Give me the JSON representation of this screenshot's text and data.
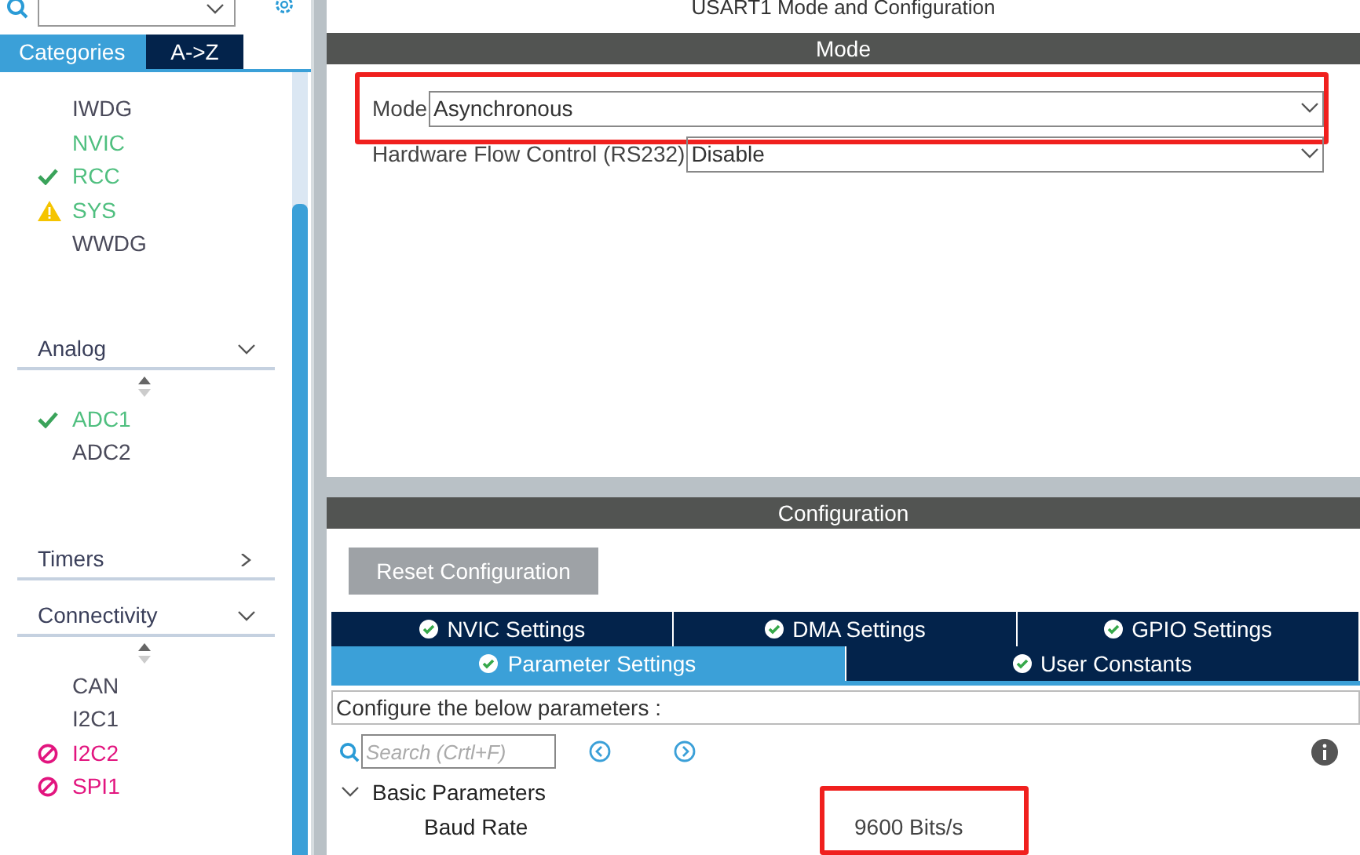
{
  "sidebar": {
    "tabs": [
      {
        "label": "Categories",
        "selected": true
      },
      {
        "label": "A->Z",
        "selected": false
      }
    ],
    "groups": [
      {
        "items": [
          {
            "label": "IWDG",
            "kind": "plain"
          },
          {
            "label": "NVIC",
            "kind": "enabled"
          },
          {
            "label": "RCC",
            "kind": "ok"
          },
          {
            "label": "SYS",
            "kind": "warning"
          },
          {
            "label": "WWDG",
            "kind": "plain"
          }
        ]
      },
      {
        "title": "Analog",
        "expanded": true,
        "items": [
          {
            "label": "ADC1",
            "kind": "ok"
          },
          {
            "label": "ADC2",
            "kind": "plain"
          }
        ]
      },
      {
        "title": "Timers",
        "expanded": false
      },
      {
        "title": "Connectivity",
        "expanded": true,
        "items": [
          {
            "label": "CAN",
            "kind": "plain"
          },
          {
            "label": "I2C1",
            "kind": "plain"
          },
          {
            "label": "I2C2",
            "kind": "blocked"
          },
          {
            "label": "SPI1",
            "kind": "blocked"
          }
        ]
      }
    ]
  },
  "main": {
    "title": "USART1 Mode and Configuration",
    "mode_header": "Mode",
    "fields": [
      {
        "label": "Mode",
        "value": "Asynchronous",
        "highlighted": true
      },
      {
        "label": "Hardware Flow Control (RS232)",
        "value": "Disable",
        "highlighted": false
      }
    ],
    "config_header": "Configuration",
    "reset_button": "Reset Configuration",
    "tab_rows": [
      [
        {
          "label": "NVIC Settings",
          "selected": false
        },
        {
          "label": "DMA Settings",
          "selected": false
        },
        {
          "label": "GPIO Settings",
          "selected": false
        }
      ],
      [
        {
          "label": "Parameter Settings",
          "selected": true
        },
        {
          "label": "User Constants",
          "selected": false
        }
      ]
    ],
    "hint": "Configure the below parameters :",
    "search": {
      "placeholder": "Search (Crtl+F)"
    },
    "section": {
      "title": "Basic Parameters",
      "expanded": true,
      "params": [
        {
          "name": "Baud Rate",
          "value": "9600 Bits/s",
          "highlighted": true
        }
      ]
    }
  }
}
